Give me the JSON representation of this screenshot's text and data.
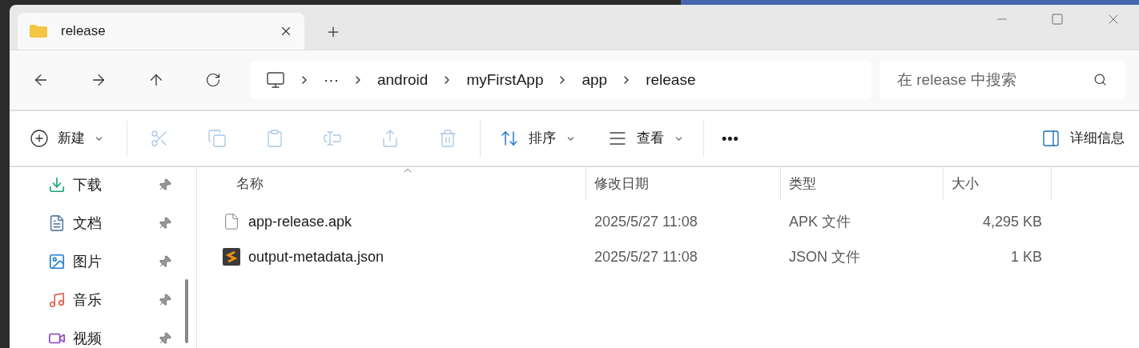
{
  "tabs": [
    {
      "label": "release",
      "selected": true
    }
  ],
  "address": {
    "breadcrumbs": [
      "···",
      "android",
      "myFirstApp",
      "app",
      "release"
    ]
  },
  "search": {
    "placeholder": "在 release 中搜索"
  },
  "toolbar": {
    "new_label": "新建",
    "actions": [
      {
        "disabled": true
      },
      {
        "disabled": true
      },
      {
        "disabled": true
      },
      {
        "disabled": true
      },
      {
        "disabled": true
      },
      {
        "disabled": true
      }
    ],
    "sort_label": "排序",
    "view_label": "查看",
    "more": "•••",
    "details_label": "详细信息"
  },
  "sidebar": {
    "items": [
      {
        "label": "下载",
        "pinned": true
      },
      {
        "label": "文档",
        "pinned": true
      },
      {
        "label": "图片",
        "pinned": true
      },
      {
        "label": "音乐",
        "pinned": true
      },
      {
        "label": "视频",
        "pinned": true
      }
    ]
  },
  "table": {
    "columns": [
      {
        "label": "名称",
        "sorted": true
      },
      {
        "label": "修改日期",
        "sorted": false
      },
      {
        "label": "类型",
        "sorted": false
      },
      {
        "label": "大小",
        "sorted": false
      }
    ],
    "rows": [
      {
        "kind": "file",
        "name": "app-release.apk",
        "modified": "2025/5/27 11:08",
        "type": "APK 文件",
        "size": "4,295 KB"
      },
      {
        "kind": "script",
        "name": "output-metadata.json",
        "modified": "2025/5/27 11:08",
        "type": "JSON 文件",
        "size": "1 KB"
      }
    ]
  }
}
